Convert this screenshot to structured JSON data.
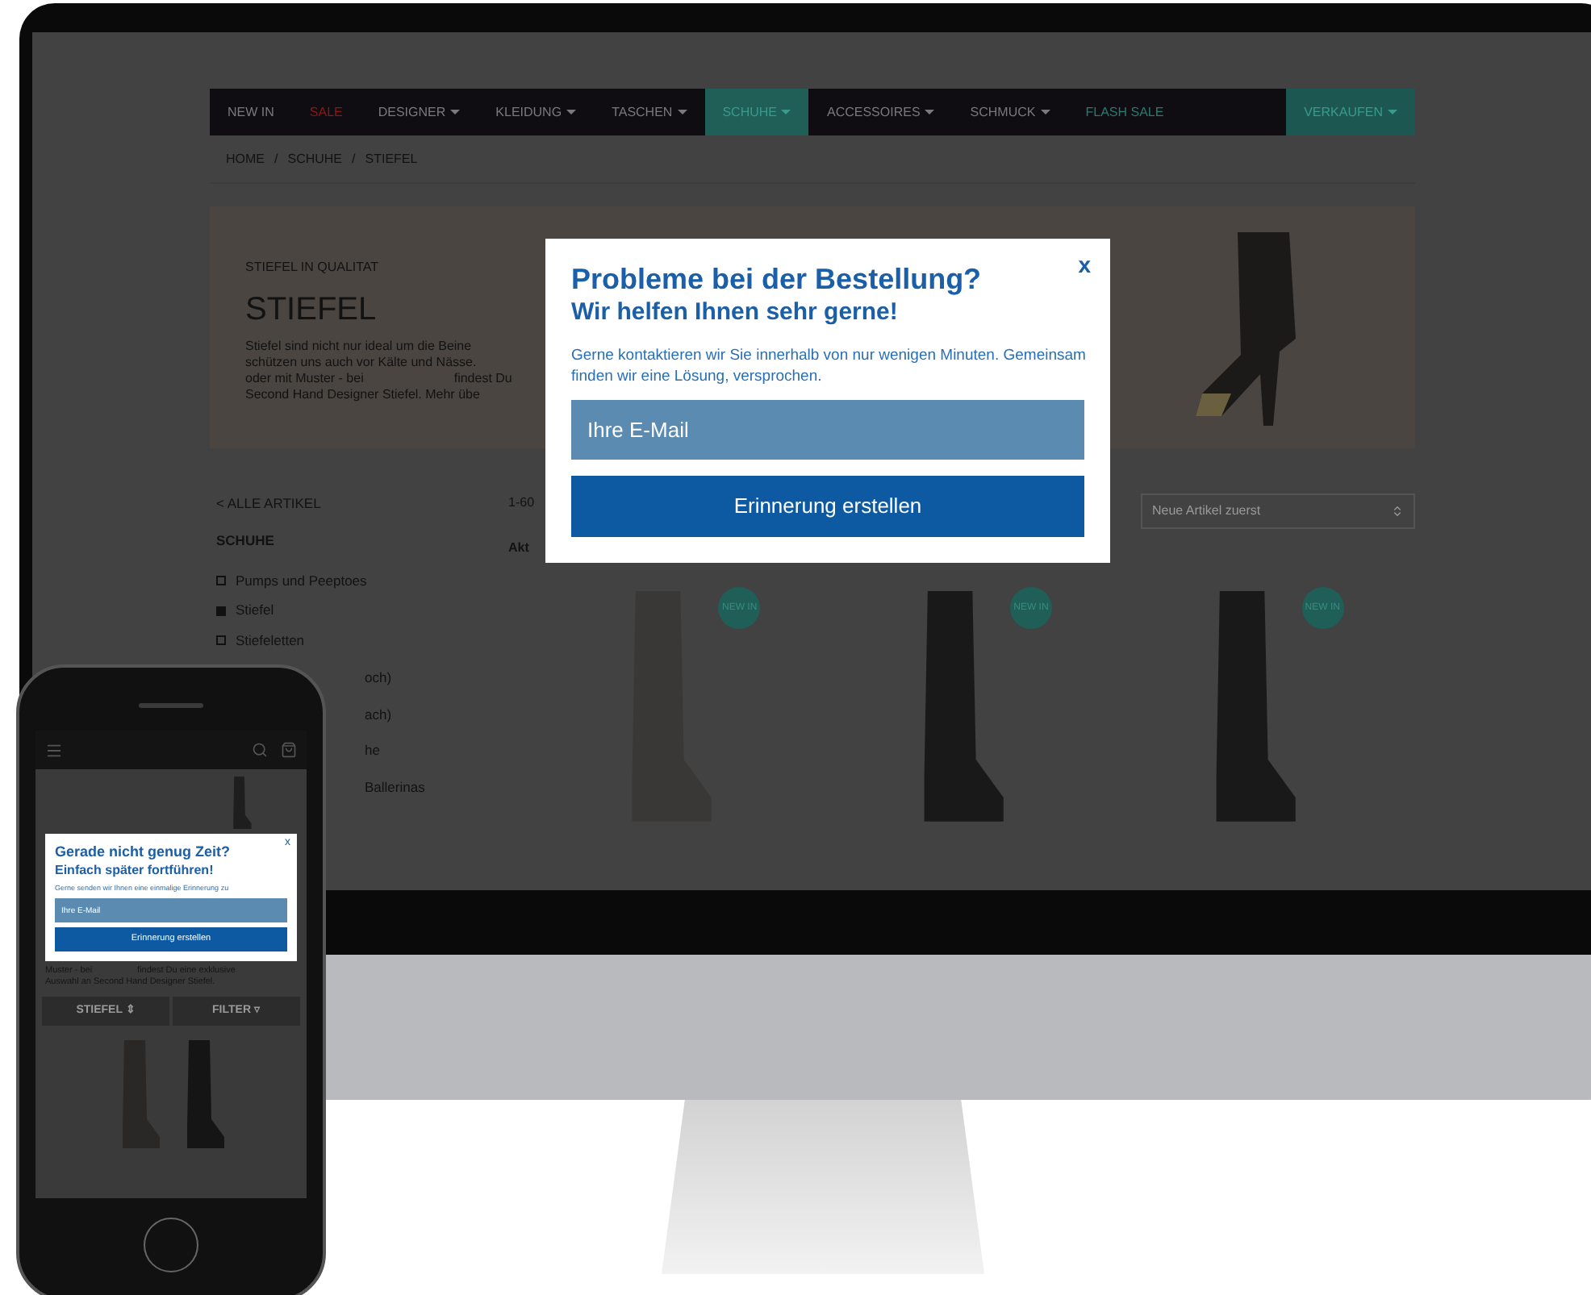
{
  "site": {
    "nav": [
      {
        "label": "NEW IN",
        "kind": "normal",
        "selected": false,
        "has_menu": false
      },
      {
        "label": "SALE",
        "kind": "sale",
        "selected": false,
        "has_menu": false
      },
      {
        "label": "DESIGNER",
        "kind": "normal",
        "selected": false,
        "has_menu": true
      },
      {
        "label": "KLEIDUNG",
        "kind": "normal",
        "selected": false,
        "has_menu": true
      },
      {
        "label": "TASCHEN",
        "kind": "normal",
        "selected": false,
        "has_menu": true
      },
      {
        "label": "SCHUHE",
        "kind": "normal",
        "selected": true,
        "has_menu": true
      },
      {
        "label": "ACCESSOIRES",
        "kind": "normal",
        "selected": false,
        "has_menu": true
      },
      {
        "label": "SCHMUCK",
        "kind": "normal",
        "selected": false,
        "has_menu": true
      },
      {
        "label": "FLASH SALE",
        "kind": "flash",
        "selected": false,
        "has_menu": false
      },
      {
        "label": "VERKAUFEN",
        "kind": "cta",
        "selected": false,
        "has_menu": true
      }
    ],
    "breadcrumb": [
      "HOME",
      "SCHUHE",
      "STIEFEL"
    ],
    "breadcrumb_separator": "/",
    "hero": {
      "eyebrow": "STIEFEL IN QUALITAT",
      "title": "STIEFEL",
      "lines": [
        "Stiefel sind nicht nur ideal um die Beine",
        "schützen uns auch vor Kälte und Nässe.",
        "oder mit Muster - bei",
        "findest Du",
        "Second Hand Designer Stiefel. Mehr übe"
      ]
    },
    "sidebar": {
      "back_link": "< ALLE ARTIKEL",
      "heading": "SCHUHE",
      "items": [
        {
          "label": "Pumps und Peeptoes",
          "checked": false
        },
        {
          "label": "Stiefel",
          "checked": true
        },
        {
          "label": "Stiefeletten",
          "checked": false
        }
      ],
      "partial_labels": [
        "och)",
        "ach)",
        "he",
        "Ballerinas"
      ]
    },
    "results_count": "1-60",
    "filter_label": "Akt",
    "sort": "Neue Artikel zuerst",
    "products": [
      {
        "badge": "NEW IN"
      },
      {
        "badge": "NEW IN"
      },
      {
        "badge": "NEW IN"
      }
    ]
  },
  "modal": {
    "title": "Probleme bei der Bestellung?",
    "subtitle": "Wir helfen Ihnen sehr gerne!",
    "text": "Gerne kontaktieren wir Sie innerhalb von nur wenigen Minuten. Gemeinsam finden wir eine Lösung, versprochen.",
    "email_placeholder": "Ihre E-Mail",
    "button": "Erinnerung erstellen",
    "close": "x"
  },
  "phone": {
    "modal": {
      "title": "Gerade nicht genug Zeit?",
      "subtitle": "Einfach später fortführen!",
      "text": "Gerne senden wir Ihnen eine einmalige Erinnerung zu",
      "email_placeholder": "Ihre E-Mail",
      "button": "Erinnerung erstellen",
      "close": "x"
    },
    "text_lines": [
      "Muster - bei",
      "findest Du eine exklusive",
      "Auswahl an Second Hand Designer Stiefel."
    ],
    "buttons": [
      "STIEFEL ⇕",
      "FILTER ▿"
    ]
  }
}
